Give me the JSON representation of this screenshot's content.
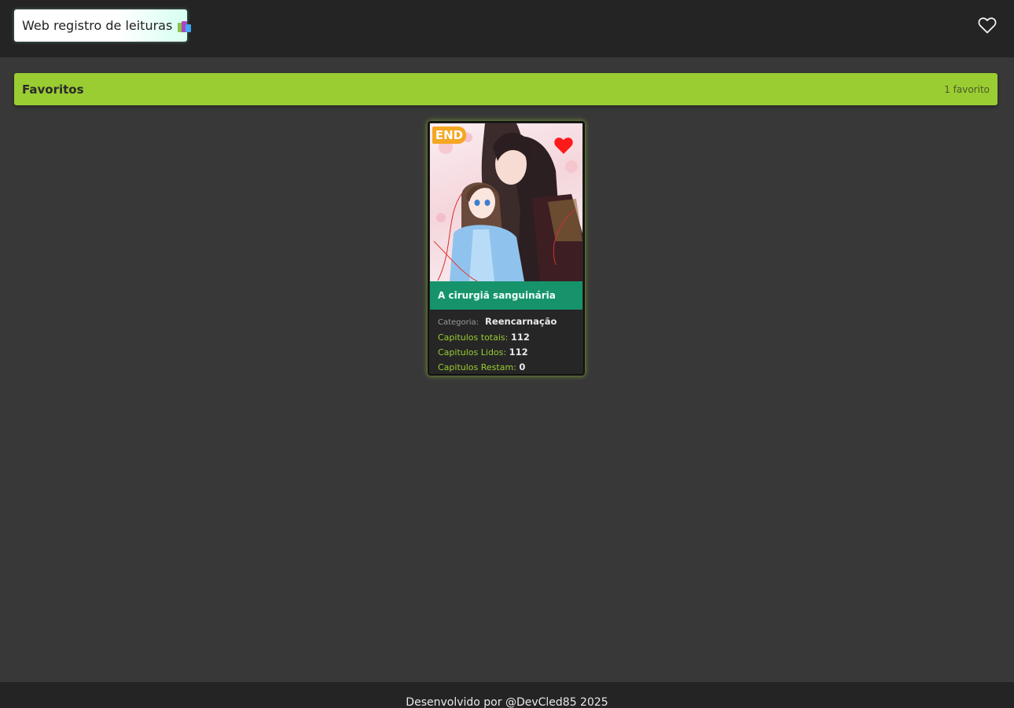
{
  "header": {
    "brand_title": "Web registro de leituras",
    "brand_icon": "books-icon",
    "favorites_icon": "heart-outline-icon"
  },
  "section": {
    "title": "Favoritos",
    "count_label": "1 favorito"
  },
  "cards": [
    {
      "status_badge": "END",
      "favorite_icon": "heart-filled-icon",
      "title": "A cirurgiã sanguinária",
      "category_label": "Categoria:",
      "category_value": "Reencarnação",
      "total_label": "Capitulos totais",
      "total_value": "112",
      "read_label": "Capitulos Lidos",
      "read_value": "112",
      "remaining_label": "Capitulos Restam",
      "remaining_value": "0"
    }
  ],
  "footer": {
    "text": "Desenvolvido por @DevCled85 2025"
  },
  "colors": {
    "topbar": "#242424",
    "background": "#383838",
    "accent_green": "#9acd32",
    "card_title_bg": "#17936b",
    "badge_orange": "#f5a623",
    "heart_red": "#ff1a1a"
  }
}
